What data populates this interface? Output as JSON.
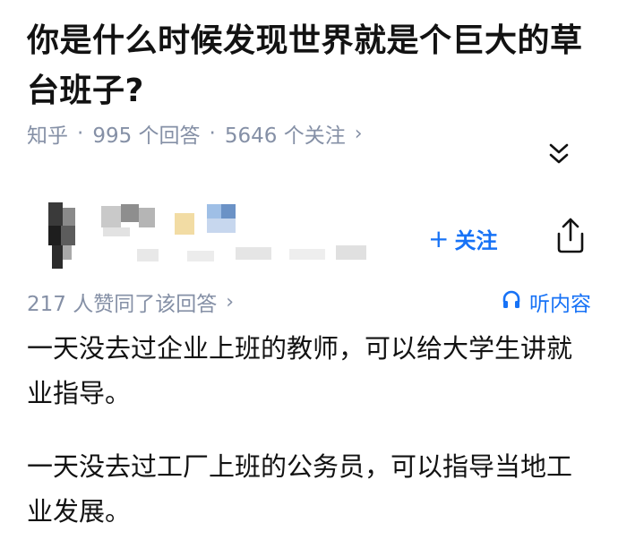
{
  "question": {
    "title": "你是什么时候发现世界就是个巨大的草台班子?"
  },
  "meta": {
    "source": "知乎",
    "separator": "·",
    "answers": "995 个回答",
    "followers": "5646 个关注",
    "chevron": "›"
  },
  "icons": {
    "collapse": "double-chevron-down-icon",
    "share": "share-icon",
    "headphones": "headphones-icon"
  },
  "author": {
    "follow_plus": "+",
    "follow_label": "关注"
  },
  "answer": {
    "likes": "217 人赞同了该回答",
    "likes_chevron": "›",
    "listen_label": "听内容",
    "paragraphs": [
      "一天没去过企业上班的教师，可以给大学生讲就业指导。",
      "一天没去过工厂上班的公务员，可以指导当地工业发展。"
    ]
  },
  "colors": {
    "accent": "#1772f6",
    "meta_text": "#8590a6",
    "text": "#121212"
  }
}
